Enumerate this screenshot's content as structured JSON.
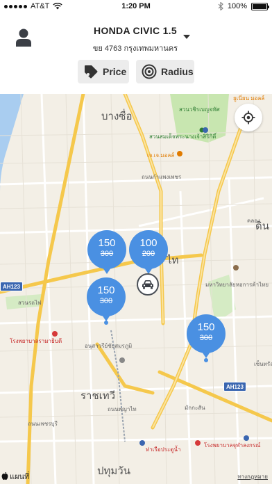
{
  "status_bar": {
    "carrier": "AT&T",
    "time": "1:20 PM",
    "battery": "100%"
  },
  "header": {
    "vehicle_name": "HONDA CIVIC 1.5",
    "vehicle_plate": "ขย 4763 กรุงเทพมหานคร",
    "price_button": "Price",
    "radius_button": "Radius"
  },
  "map": {
    "labels": {
      "bang_sue": "บางซื่อ",
      "din_daeng": "ดิน",
      "phaya_thai_suffix": "ไท",
      "ratchathewi": "ราชเทวี",
      "pathum_wan": "ปทุมวัน",
      "chatuchak_park": "สวนวชิรเบญจทัศ",
      "queen_sirikit_park": "สวนสมเด็จพระนางเจ้าสิริกิติ์",
      "jj_mall": "เจ.เจ.มอลล์",
      "phahon_road": "ถนนกำแพงเพชร",
      "anusawari": "อนุสาวรีย์ชัยสมรภูมิ",
      "ramathibodi": "โรงพยาบาลรามาธิบดี",
      "thai_chamber_univ": "มหาวิทยาลัยหอการค้าไทย",
      "chulalongkorn_hosp": "โรงพยาบาลจุฬาลงกรณ์",
      "rot_fai_park": "สวนรถไฟ",
      "phaya_thai_road": "ถนนพญาไท",
      "phetchaburi_road": "ถนนเพชรบุรี",
      "makkasan": "มักกะสัน",
      "union_mall": "ยูเนี่ยน มอลล์",
      "central": "เซ็นทรัล",
      "pier": "ท่าเรือประตูน้ำ",
      "khlong_lat": "คลอง"
    },
    "pins": [
      {
        "price": "150",
        "original": "300"
      },
      {
        "price": "100",
        "original": "200"
      },
      {
        "price": "150",
        "original": "300"
      },
      {
        "price": "150",
        "original": "300"
      }
    ],
    "shields": [
      "AH123",
      "AH123"
    ],
    "attribution": "แผนที่",
    "legal": "ทางกฎหมาย"
  },
  "colors": {
    "pin": "#4a90e2",
    "map_bg": "#f3efe6",
    "highway": "#f5c84c",
    "park": "#c8e6b0",
    "water": "#a9cdf0"
  },
  "icons": [
    "user-icon",
    "price-tag-icon",
    "radius-icon",
    "locate-icon",
    "car-icon",
    "apple-icon"
  ]
}
